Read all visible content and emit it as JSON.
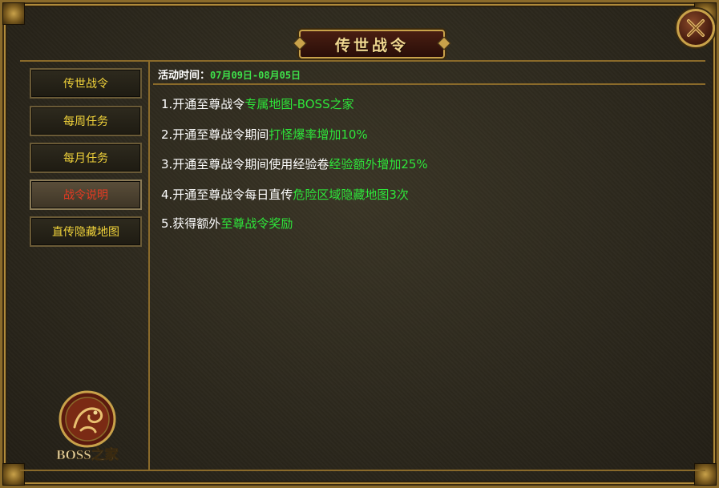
{
  "window": {
    "title": "传世战令",
    "close_icon": "close-x-icon"
  },
  "sidebar": {
    "items": [
      {
        "label": "传世战令",
        "active": false
      },
      {
        "label": "每周任务",
        "active": false
      },
      {
        "label": "每月任务",
        "active": false
      },
      {
        "label": "战令说明",
        "active": true
      },
      {
        "label": "直传隐藏地图",
        "active": false
      }
    ],
    "logo_text": "BOSS之家"
  },
  "content": {
    "time_label": "活动时间：",
    "time_value": "07月09日-08月05日",
    "items": [
      {
        "prefix": "1.开通至尊战令",
        "highlight": "专属地图-BOSS之家"
      },
      {
        "prefix": "2.开通至尊战令期间",
        "highlight": "打怪爆率增加10%"
      },
      {
        "prefix": "3.开通至尊战令期间使用经验卷",
        "highlight": "经验额外增加25%"
      },
      {
        "prefix": "4.开通至尊战令每日直传",
        "highlight": "危险区域隐藏地图3次"
      },
      {
        "prefix": "5.获得额外",
        "highlight": "至尊战令奖励"
      }
    ]
  },
  "colors": {
    "highlight": "#2ee63a",
    "nav_text": "#f0d23a",
    "nav_active_text": "#e83a22",
    "border_gold": "#c9a24a"
  }
}
